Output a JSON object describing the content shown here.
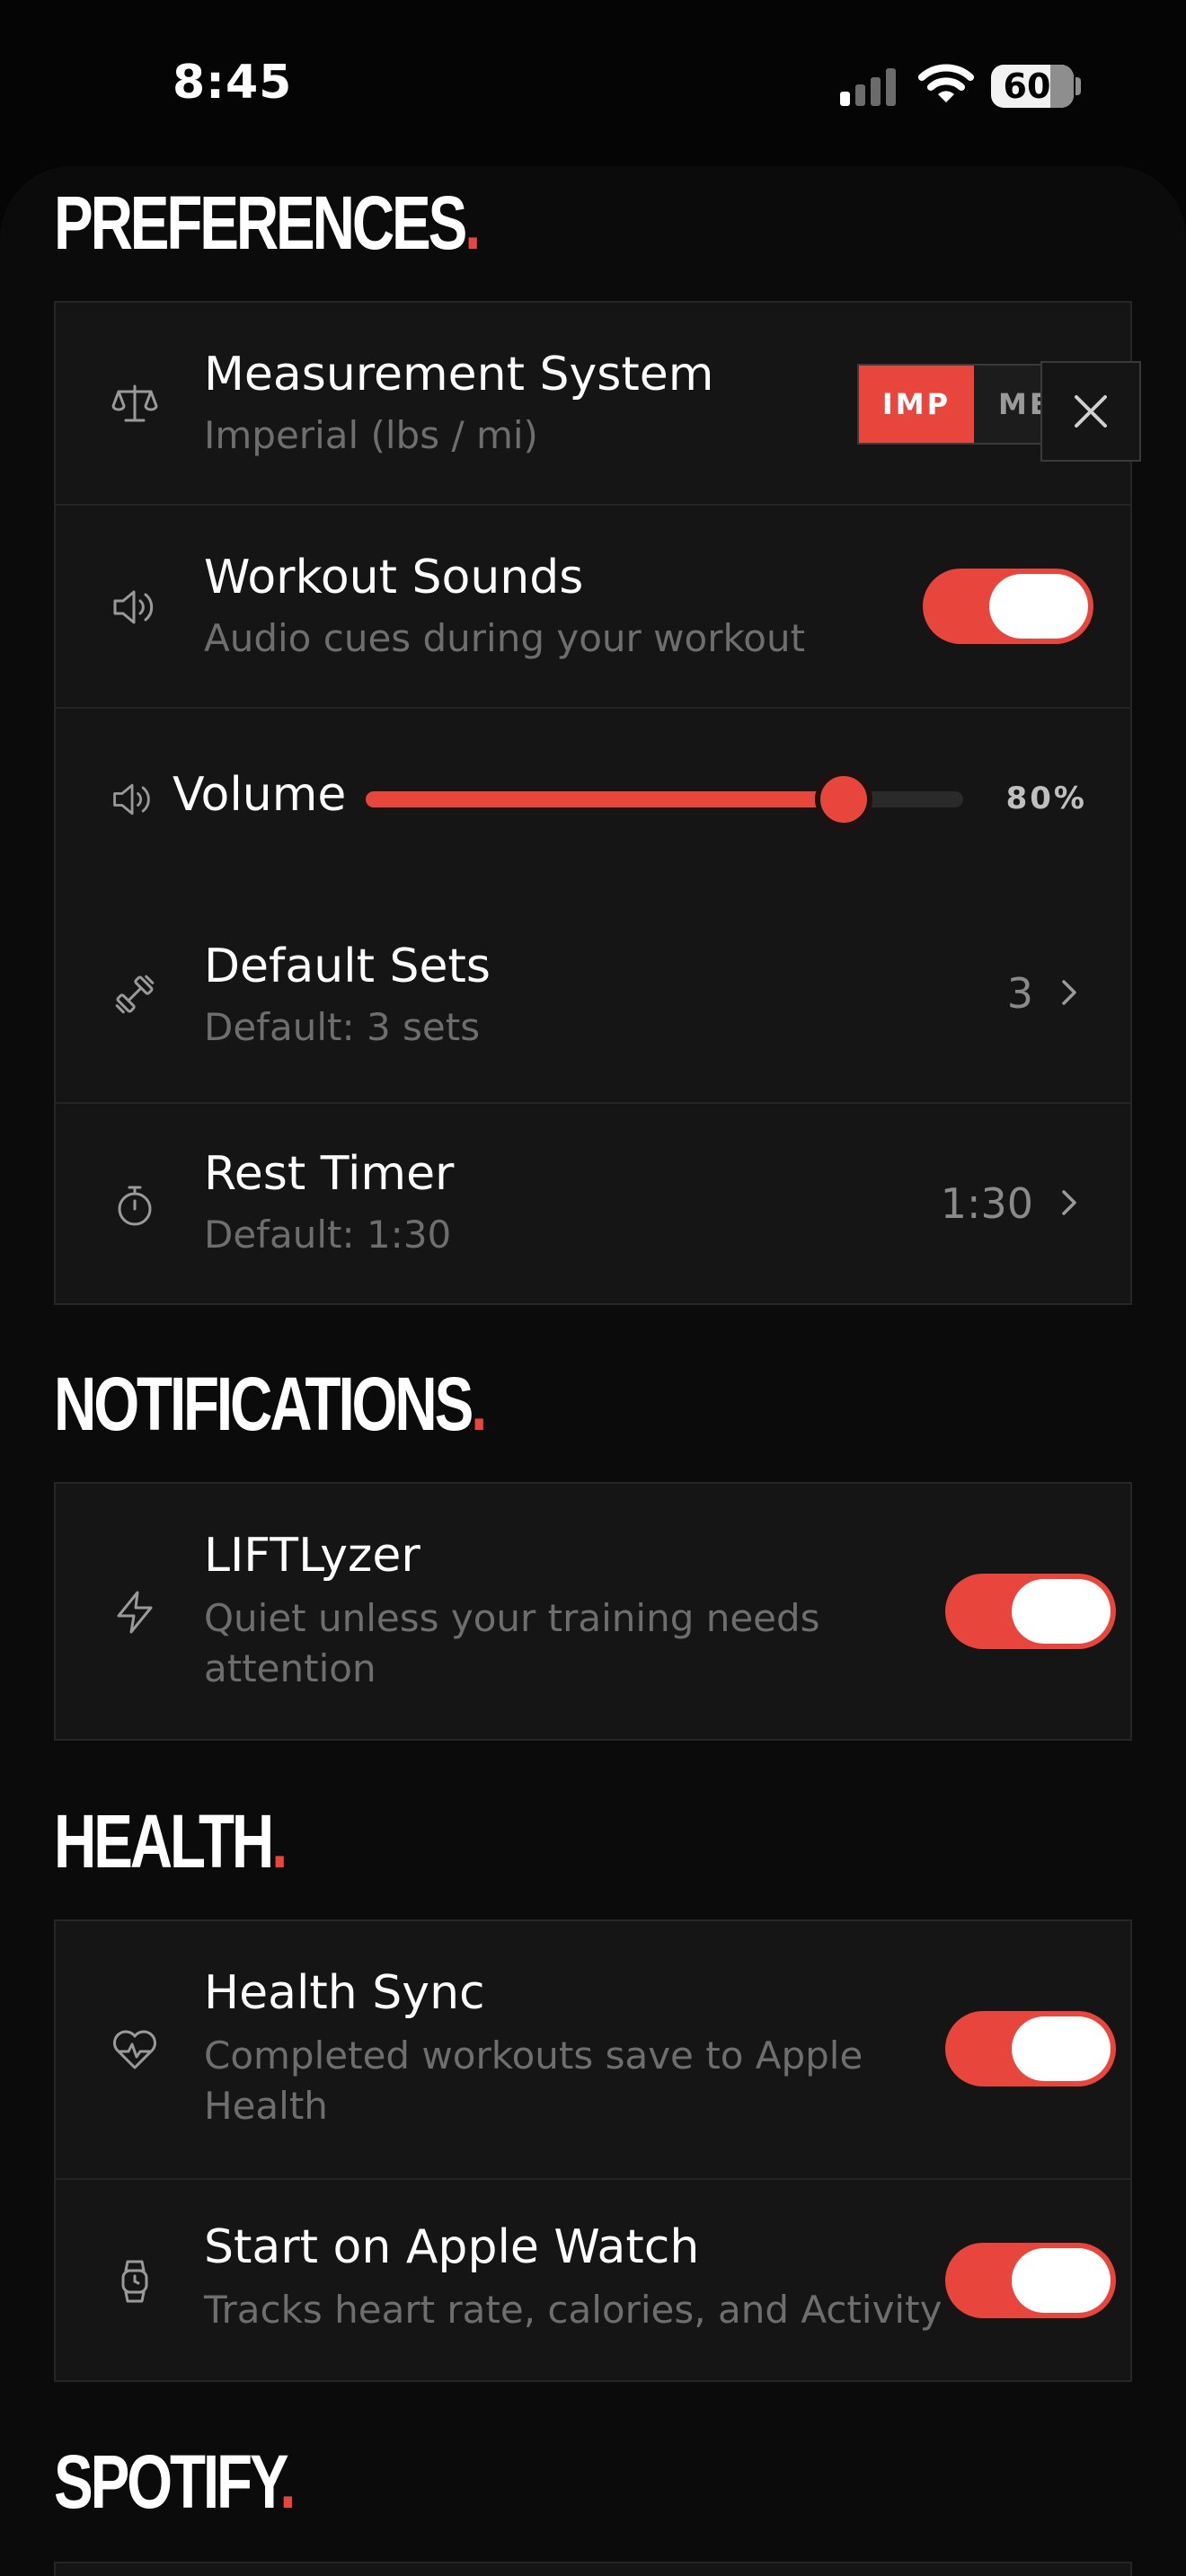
{
  "status_bar": {
    "time": "8:45",
    "battery": "60",
    "signal_icon": "cellular-signal-icon",
    "wifi_icon": "wifi-icon"
  },
  "colors": {
    "accent": "#e8453c",
    "background": "#050505",
    "card": "#151515",
    "subtitle": "#6e6e6e"
  },
  "preferences": {
    "title": "PREFERENCES",
    "measurement": {
      "title": "Measurement System",
      "subtitle": "Imperial (lbs / mi)",
      "icon": "scale-icon",
      "option_active": "IMP",
      "option_inactive": "ME",
      "close_icon": "close-icon"
    },
    "workout_sounds": {
      "title": "Workout Sounds",
      "subtitle": "Audio cues during your workout",
      "icon": "speaker-icon",
      "enabled": true
    },
    "volume": {
      "label": "Volume",
      "value_text": "80%",
      "level": 0.8,
      "icon": "speaker-icon"
    },
    "default_sets": {
      "title": "Default Sets",
      "subtitle": "Default: 3 sets",
      "value": "3",
      "icon": "dumbbell-icon"
    },
    "rest_timer": {
      "title": "Rest Timer",
      "subtitle": "Default: 1:30",
      "value": "1:30",
      "icon": "stopwatch-icon"
    }
  },
  "notifications": {
    "title": "NOTIFICATIONS",
    "liftlyzer": {
      "title": "LIFTLyzer",
      "subtitle": "Quiet unless your training needs attention",
      "icon": "lightning-icon",
      "enabled": true
    }
  },
  "health": {
    "title": "HEALTH",
    "health_sync": {
      "title": "Health Sync",
      "subtitle": "Completed workouts save to Apple Health",
      "icon": "heart-pulse-icon",
      "enabled": true
    },
    "apple_watch": {
      "title": "Start on Apple Watch",
      "subtitle": "Tracks heart rate, calories, and Activity",
      "icon": "watch-icon",
      "enabled": true
    }
  },
  "spotify": {
    "title": "SPOTIFY"
  },
  "title_dot": "."
}
